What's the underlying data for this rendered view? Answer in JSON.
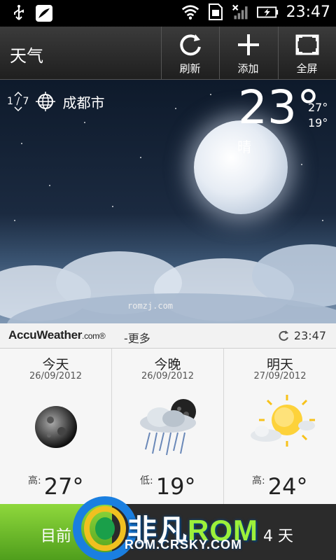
{
  "status_bar": {
    "time": "23:47",
    "icons": [
      "usb-icon",
      "app-notification-icon",
      "wifi-icon",
      "sim-icon",
      "signal-icon",
      "battery-charging-icon"
    ]
  },
  "header": {
    "title": "天气",
    "actions": [
      {
        "label": "刷新",
        "icon": "refresh-icon"
      },
      {
        "label": "添加",
        "icon": "plus-icon"
      },
      {
        "label": "全屏",
        "icon": "fullscreen-icon"
      }
    ]
  },
  "current": {
    "page_top": "1",
    "page_bottom": "7",
    "city": "成都市",
    "temp": "23°",
    "high": "27°",
    "low": "19°",
    "condition": "晴",
    "scene_watermark": "romzj.com"
  },
  "provider": {
    "brand": "AccuWeather",
    "brand_suffix": ".com",
    "brand_mark": "®",
    "more": "-更多",
    "updated_time": "23:47"
  },
  "forecast": [
    {
      "day": "今天",
      "date": "26/09/2012",
      "temp_label": "高:",
      "temp": "27°",
      "icon": "moon-icon"
    },
    {
      "day": "今晚",
      "date": "26/09/2012",
      "temp_label": "低:",
      "temp": "19°",
      "icon": "night-rain-icon"
    },
    {
      "day": "明天",
      "date": "27/09/2012",
      "temp_label": "高:",
      "temp": "24°",
      "icon": "sun-cloud-icon"
    }
  ],
  "bottom_tabs": {
    "now": "目前",
    "four_day": "4 天"
  },
  "overlay_logo": {
    "title_a": "非凡",
    "title_b": "ROM",
    "subtitle": "ROM.CRSKY.COM"
  },
  "colors": {
    "active_tab": "#6bbf2a",
    "logo_accent": "#9cf03a"
  }
}
